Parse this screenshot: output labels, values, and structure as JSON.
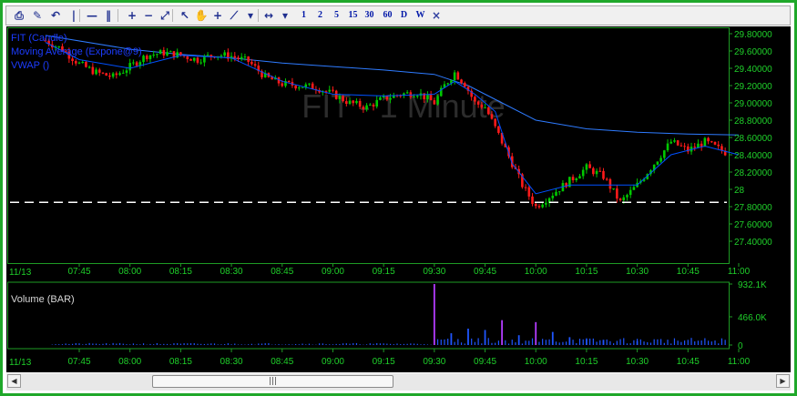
{
  "toolbar": {
    "buttons": [
      {
        "name": "print-icon",
        "glyph": "⎙"
      },
      {
        "name": "chart-draw-icon",
        "glyph": "✎"
      },
      {
        "name": "undo-icon",
        "glyph": "↶"
      },
      {
        "name": "vertical-line-icon",
        "glyph": "|"
      },
      {
        "name": "horizontal-line-icon",
        "glyph": "—"
      },
      {
        "name": "pause-bars-icon",
        "glyph": "‖"
      },
      {
        "name": "zoom-in-icon",
        "glyph": "+"
      },
      {
        "name": "zoom-out-icon",
        "glyph": "−"
      },
      {
        "name": "fit-screen-icon",
        "glyph": "⤢"
      },
      {
        "name": "pointer-icon",
        "glyph": "↖"
      },
      {
        "name": "hand-icon",
        "glyph": "✋"
      },
      {
        "name": "crosshair-icon",
        "glyph": "+"
      },
      {
        "name": "trend-line-icon",
        "glyph": "⟋"
      },
      {
        "name": "dropdown-icon",
        "glyph": "▾"
      },
      {
        "name": "scroll-arrows-icon",
        "glyph": "↔"
      },
      {
        "name": "dropdown-icon",
        "glyph": "▾"
      }
    ],
    "intervals": [
      "1",
      "2",
      "5",
      "15",
      "30",
      "60",
      "D",
      "W"
    ],
    "close_glyph": "×"
  },
  "chart": {
    "watermark": "FIT - 1 Minute",
    "legend": [
      "FIT (Candle)",
      "Moving Average (Expone@9)",
      "VWAP ()"
    ],
    "date_label": "11/13",
    "volume_title": "Volume (BAR)",
    "price_ticks": [
      "29.80000",
      "29.60000",
      "29.40000",
      "29.20000",
      "29.00000",
      "28.80000",
      "28.60000",
      "28.40000",
      "28.20000",
      "28",
      "27.80000",
      "27.60000",
      "27.40000"
    ],
    "time_ticks": [
      "07:45",
      "08:00",
      "08:15",
      "08:30",
      "08:45",
      "09:00",
      "09:15",
      "09:30",
      "09:45",
      "10:00",
      "10:15",
      "10:30",
      "10:45",
      "11:00"
    ],
    "volume_ticks": [
      "932.1K",
      "466.0K",
      "0"
    ],
    "colors": {
      "up": "#00c800",
      "down": "#ff1a1a",
      "ema": "#0050ff",
      "vwap": "#2e7bff",
      "grid": "#0b4f10",
      "axis": "#1e9b24",
      "ticktext": "#1fd02a",
      "volume": "#1f56ff",
      "volume_hi": "#b43cff",
      "baseline": "#ffffff"
    }
  },
  "chart_data": {
    "type": "candlestick",
    "title": "FIT - 1 Minute",
    "ylim": [
      27.3,
      29.85
    ],
    "reference_level": 27.85,
    "series": [
      {
        "name": "FIT (Candle)",
        "kind": "close_path",
        "times": [
          "07:35",
          "07:40",
          "07:45",
          "07:50",
          "07:55",
          "08:00",
          "08:05",
          "08:10",
          "08:15",
          "08:20",
          "08:25",
          "08:30",
          "08:35",
          "08:40",
          "08:45",
          "08:50",
          "08:55",
          "09:00",
          "09:05",
          "09:10",
          "09:15",
          "09:20",
          "09:25",
          "09:30",
          "09:33",
          "09:36",
          "09:39",
          "09:42",
          "09:45",
          "09:50",
          "09:53",
          "09:56",
          "10:00",
          "10:05",
          "10:10",
          "10:15",
          "10:20",
          "10:25",
          "10:30",
          "10:35",
          "10:40",
          "10:45",
          "10:50",
          "10:55",
          "11:00"
        ],
        "values": [
          29.72,
          29.62,
          29.45,
          29.35,
          29.3,
          29.42,
          29.55,
          29.58,
          29.55,
          29.5,
          29.56,
          29.54,
          29.48,
          29.3,
          29.22,
          29.2,
          29.18,
          29.1,
          29.0,
          28.95,
          29.05,
          29.1,
          29.12,
          29.0,
          29.2,
          29.35,
          29.22,
          29.0,
          28.95,
          28.55,
          28.3,
          28.05,
          27.8,
          27.95,
          28.1,
          28.25,
          28.15,
          27.85,
          28.05,
          28.3,
          28.55,
          28.45,
          28.55,
          28.45,
          28.35
        ]
      },
      {
        "name": "Moving Average (Expone@9)",
        "kind": "line",
        "times": [
          "07:35",
          "07:45",
          "08:00",
          "08:15",
          "08:30",
          "08:45",
          "09:00",
          "09:15",
          "09:30",
          "09:36",
          "09:42",
          "09:48",
          "09:53",
          "10:00",
          "10:10",
          "10:20",
          "10:30",
          "10:40",
          "10:50",
          "11:00"
        ],
        "values": [
          29.7,
          29.5,
          29.4,
          29.55,
          29.52,
          29.25,
          29.1,
          29.08,
          29.1,
          29.25,
          29.1,
          28.9,
          28.3,
          27.95,
          28.05,
          28.05,
          28.05,
          28.4,
          28.5,
          28.4
        ]
      },
      {
        "name": "VWAP ()",
        "kind": "line",
        "times": [
          "07:35",
          "08:00",
          "08:15",
          "08:30",
          "08:45",
          "09:00",
          "09:15",
          "09:30",
          "09:40",
          "09:50",
          "10:00",
          "10:15",
          "10:30",
          "10:45",
          "11:00"
        ],
        "values": [
          29.78,
          29.62,
          29.56,
          29.52,
          29.46,
          29.42,
          29.38,
          29.33,
          29.2,
          29.0,
          28.8,
          28.7,
          28.66,
          28.64,
          28.63
        ]
      }
    ],
    "volume": {
      "name": "Volume (BAR)",
      "ylim": [
        0,
        932100
      ],
      "times": [
        "09:30",
        "09:35",
        "09:40",
        "09:45",
        "09:50",
        "09:55",
        "10:00",
        "10:05",
        "10:10",
        "10:15",
        "10:20",
        "10:30"
      ],
      "values": [
        932100,
        180000,
        250000,
        230000,
        380000,
        150000,
        350000,
        200000,
        120000,
        90000,
        80000,
        60000
      ]
    }
  }
}
